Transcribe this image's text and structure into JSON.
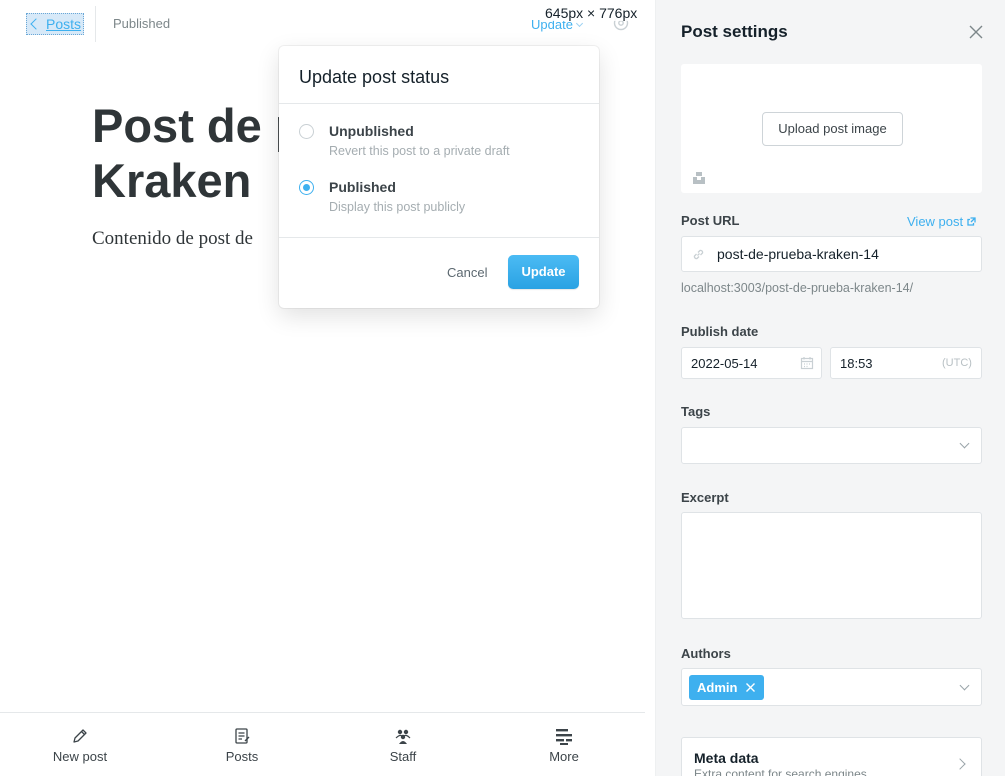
{
  "header": {
    "back_label": "Posts",
    "status": "Published",
    "update_label": "Update",
    "dimension_overlay": "645px × 776px"
  },
  "post": {
    "title": "Post de prueba Kraken",
    "title_line1": "Post de p",
    "title_line2": "Kraken",
    "body": "Contenido de post de"
  },
  "status_popup": {
    "title": "Update post status",
    "options": [
      {
        "label": "Unpublished",
        "description": "Revert this post to a private draft",
        "selected": false
      },
      {
        "label": "Published",
        "description": "Display this post publicly",
        "selected": true
      }
    ],
    "cancel_label": "Cancel",
    "update_label": "Update"
  },
  "bottom_nav": {
    "items": [
      {
        "label": "New post",
        "icon": "pencil-icon"
      },
      {
        "label": "Posts",
        "icon": "posts-icon"
      },
      {
        "label": "Staff",
        "icon": "staff-icon"
      },
      {
        "label": "More",
        "icon": "more-icon"
      }
    ]
  },
  "settings": {
    "title": "Post settings",
    "upload_image_label": "Upload post image",
    "post_url_label": "Post URL",
    "view_post_label": "View post",
    "post_url_value": "post-de-prueba-kraken-14",
    "post_url_hint": "localhost:3003/post-de-prueba-kraken-14/",
    "publish_date_label": "Publish date",
    "publish_date": "2022-05-14",
    "publish_time": "18:53",
    "timezone": "(UTC)",
    "tags_label": "Tags",
    "excerpt_label": "Excerpt",
    "authors_label": "Authors",
    "author_chip": "Admin",
    "meta_title": "Meta data",
    "meta_subtitle": "Extra content for search engines"
  },
  "colors": {
    "accent": "#3eb0ef",
    "panel_bg": "#f4f5f6",
    "text": "#15212a"
  }
}
